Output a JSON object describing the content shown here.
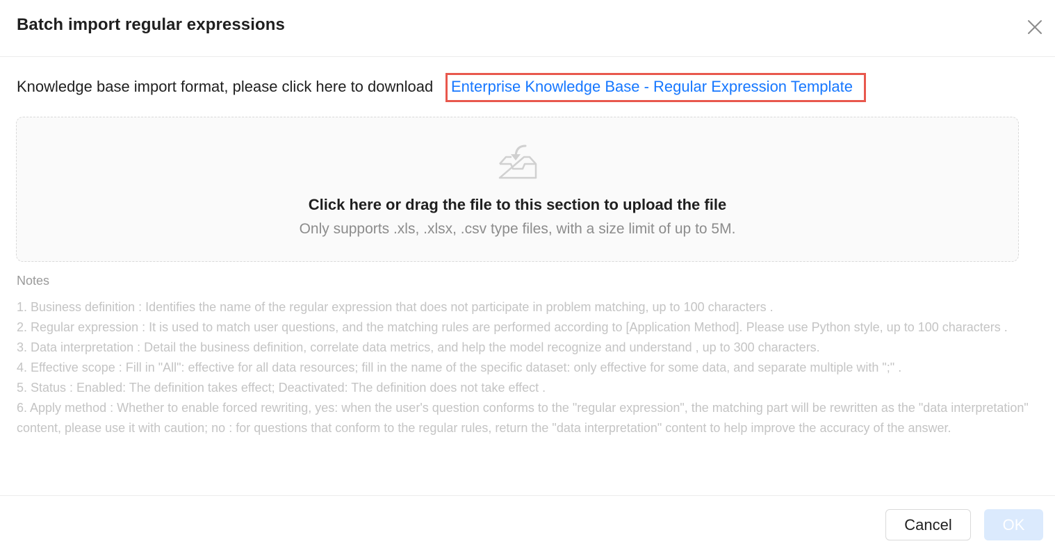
{
  "dialog": {
    "title": "Batch import regular expressions",
    "close_icon": "close-icon"
  },
  "download": {
    "prefix_text": "Knowledge base import format, please click here to download",
    "template_link": "Enterprise Knowledge Base - Regular Expression Template",
    "highlight_color": "#e8584d",
    "link_color": "#1677ff"
  },
  "upload": {
    "icon": "inbox-download-icon",
    "title": "Click here or drag the file to this section to upload the file",
    "hint": "Only supports .xls, .xlsx, .csv type files, with a size limit of up to 5M."
  },
  "notes": {
    "title": "Notes",
    "items": [
      "1. Business definition : Identifies the name of the regular expression that does not participate in problem matching, up to 100 characters .",
      "2. Regular expression : It is used to match user questions, and the matching rules are performed according to [Application Method]. Please use Python style, up to 100 characters .",
      "3. Data interpretation : Detail the business definition, correlate data metrics, and help the model recognize and understand , up to 300 characters.",
      "4. Effective scope : Fill in \"All\": effective for all data resources; fill in the name of the specific dataset: only effective for some data, and separate multiple with \";\" .",
      "5. Status : Enabled: The definition takes effect; Deactivated: The definition does not take effect .",
      "6. Apply method : Whether to enable forced rewriting, yes: when the user's question conforms to the \"regular expression\", the matching part will be rewritten as the \"data interpretation\" content, please use it with caution; no : for questions that conform to the regular rules, return the \"data interpretation\" content to help improve the accuracy of the answer."
    ]
  },
  "footer": {
    "cancel_label": "Cancel",
    "ok_label": "OK",
    "ok_disabled_color": "#dbeafd"
  }
}
